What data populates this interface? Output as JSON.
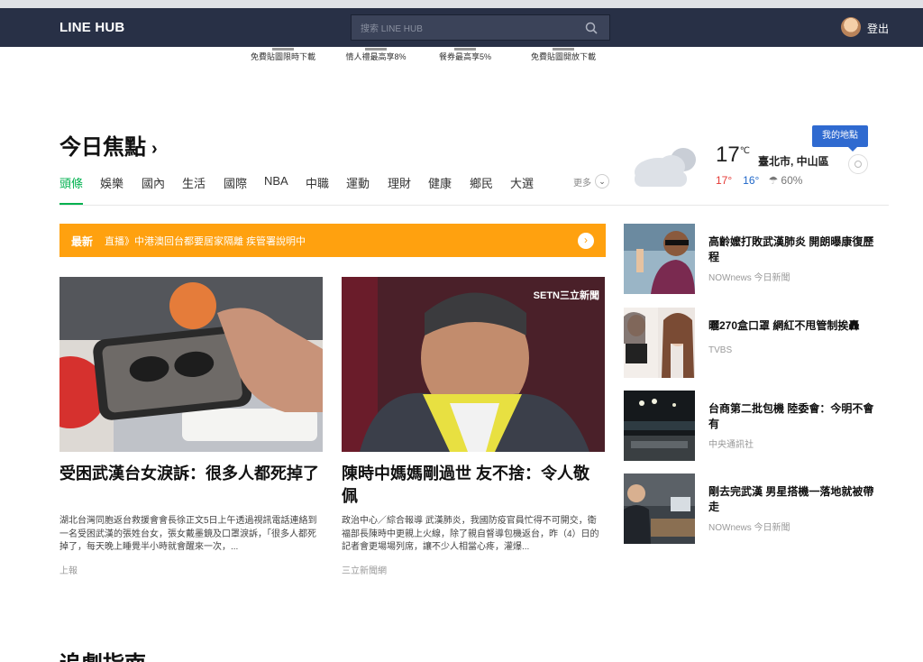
{
  "header": {
    "logo": "LINE HUB",
    "search_placeholder": "搜索 LINE HUB",
    "logout_label": "登出"
  },
  "promos": [
    {
      "label": "免費貼圖限時下載"
    },
    {
      "label": "情人禮最高享8%"
    },
    {
      "label": "餐券最高享5%"
    },
    {
      "label": "免費貼圖開放下載"
    }
  ],
  "section": {
    "title": "今日焦點",
    "chevron": "›"
  },
  "tabs": [
    {
      "label": "頭條"
    },
    {
      "label": "娛樂"
    },
    {
      "label": "國內"
    },
    {
      "label": "生活"
    },
    {
      "label": "國際"
    },
    {
      "label": "NBA"
    },
    {
      "label": "中職"
    },
    {
      "label": "運動"
    },
    {
      "label": "理財"
    },
    {
      "label": "健康"
    },
    {
      "label": "鄉民"
    },
    {
      "label": "大選"
    }
  ],
  "more": {
    "label": "更多"
  },
  "weather": {
    "temp": "17",
    "unit": "℃",
    "city": "臺北市, 中山區",
    "high": "17°",
    "low": "16°",
    "rain": "60%",
    "my_location_label": "我的地點"
  },
  "breaking": {
    "tag": "最新",
    "text": "直播》中港澳回台都要居家隔離 疾管署說明中"
  },
  "cards": [
    {
      "title": "受困武漢台女淚訴：很多人都死掉了",
      "summary": "湖北台灣同胞返台救援會會長徐正文5日上午透過視訊電話連絡到一名受困武漢的張姓台女，張女戴墨鏡及口罩淚訴，「很多人都死掉了，每天晚上睡覺半小時就會醒來一次，...",
      "source": "上報"
    },
    {
      "title": "陳時中媽媽剛過世 友不捨：令人敬佩",
      "summary": "政治中心／綜合報導 武漢肺炎，我國防疫官員忙得不可開交，衛福部長陳時中更親上火線，除了親自督導包機返台，昨（4）日的記者會更場場列席，讓不少人相當心疼，灌爆...",
      "source": "三立新聞網",
      "image_caption": "SETN三立新聞"
    }
  ],
  "side_news": [
    {
      "title": "高齡嬤打敗武漢肺炎 開朗曝康復歷程",
      "source": "NOWnews 今日新聞"
    },
    {
      "title": "曬270盒口罩 網紅不甩管制挨轟",
      "source": "TVBS"
    },
    {
      "title": "台商第二批包機 陸委會：今明不會有",
      "source": "中央通訊社"
    },
    {
      "title": "剛去完武漢 男星搭機一落地就被帶走",
      "source": "NOWnews 今日新聞"
    }
  ],
  "next_section": {
    "title": "追劇指南"
  },
  "colors": {
    "header_bg": "#283046",
    "accent_green": "#00b14f",
    "breaking_orange": "#ffa10f",
    "location_blue": "#2f6ad0"
  }
}
